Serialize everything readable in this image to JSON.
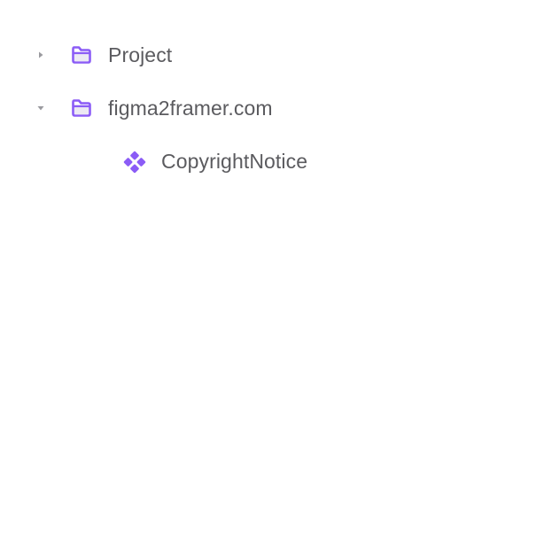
{
  "theme": {
    "accent": "#8b5cf6",
    "text": "#5b5b5f",
    "caret": "#9a9a9f",
    "background": "#ffffff"
  },
  "tree": {
    "items": [
      {
        "label": "Project",
        "icon": "folder-icon",
        "expanded": false,
        "has_caret": true
      },
      {
        "label": "figma2framer.com",
        "icon": "folder-icon",
        "expanded": true,
        "has_caret": true
      },
      {
        "label": "CopyrightNotice",
        "icon": "component-icon",
        "has_caret": false
      }
    ]
  }
}
